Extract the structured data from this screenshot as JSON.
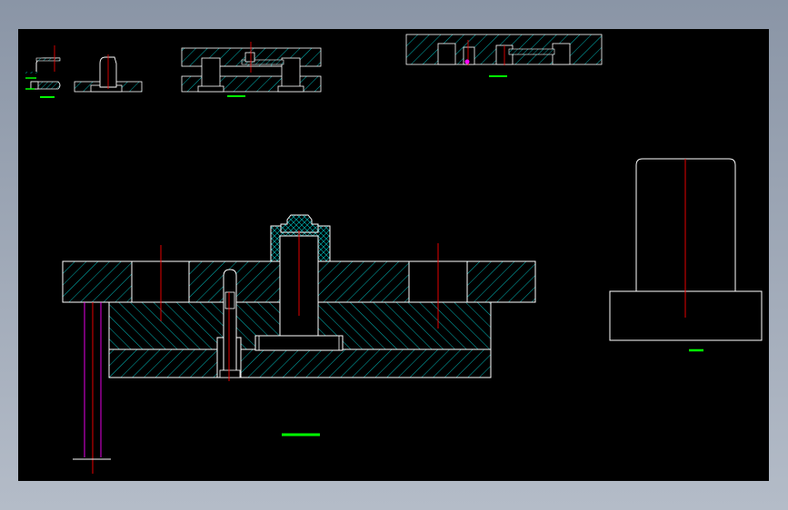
{
  "colors": {
    "background": "#000000",
    "frame": "#8a95a6",
    "outline": "#ffffff",
    "hatch": "#00c8c8",
    "centerline": "#ff0000",
    "dimension": "#ff00ff",
    "caption": "#00ff00"
  },
  "captions": {
    "small_detail_a": "",
    "small_detail_b": "",
    "strip_section": "",
    "top_section": "",
    "main_assembly": "",
    "side_part": ""
  }
}
